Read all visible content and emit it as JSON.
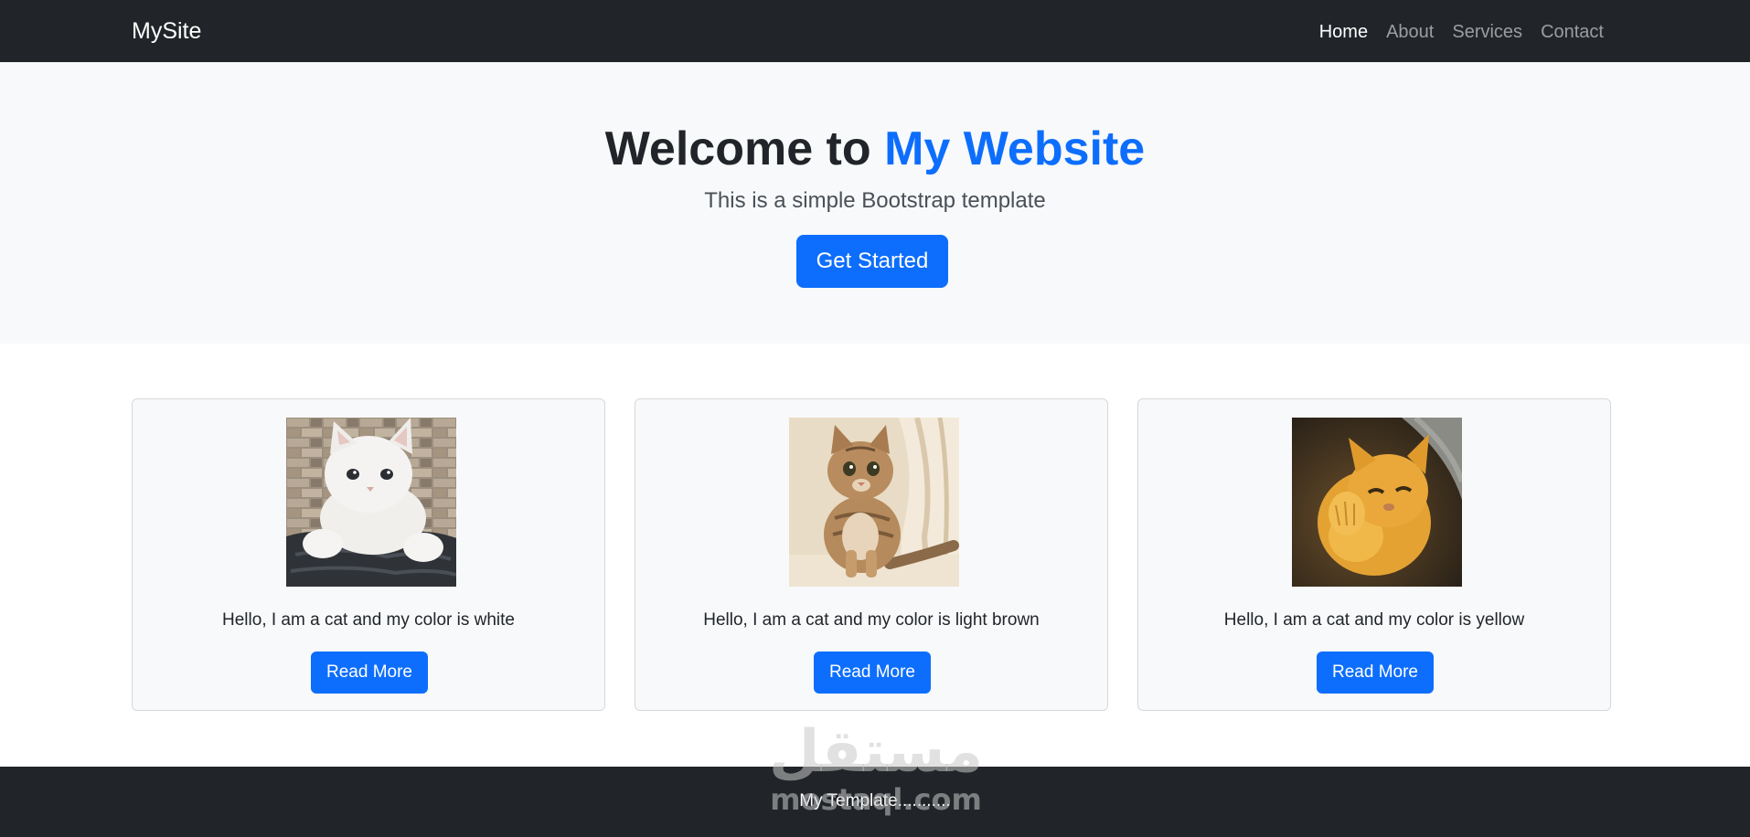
{
  "navbar": {
    "brand": "MySite",
    "links": [
      {
        "label": "Home",
        "active": true
      },
      {
        "label": "About",
        "active": false
      },
      {
        "label": "Services",
        "active": false
      },
      {
        "label": "Contact",
        "active": false
      }
    ]
  },
  "hero": {
    "title_prefix": "Welcome to ",
    "title_accent": "My Website",
    "subtitle": "This is a simple Bootstrap template",
    "button_label": "Get Started"
  },
  "cards": [
    {
      "text": "Hello, I am a cat and my color is white",
      "button_label": "Read More",
      "image_icon": "white-kitten-photo"
    },
    {
      "text": "Hello, I am a cat and my color is light brown",
      "button_label": "Read More",
      "image_icon": "tabby-cat-photo"
    },
    {
      "text": "Hello, I am a cat and my color is yellow",
      "button_label": "Read More",
      "image_icon": "yellow-kitten-photo"
    }
  ],
  "footer": {
    "text": "My Template..........."
  },
  "watermark": {
    "arabic": "مستقل",
    "latin": "mostaql.com"
  },
  "colors": {
    "navbar_bg": "#212529",
    "hero_bg": "#f8f9fa",
    "primary": "#0d6efd",
    "footer_bg": "#212529"
  }
}
